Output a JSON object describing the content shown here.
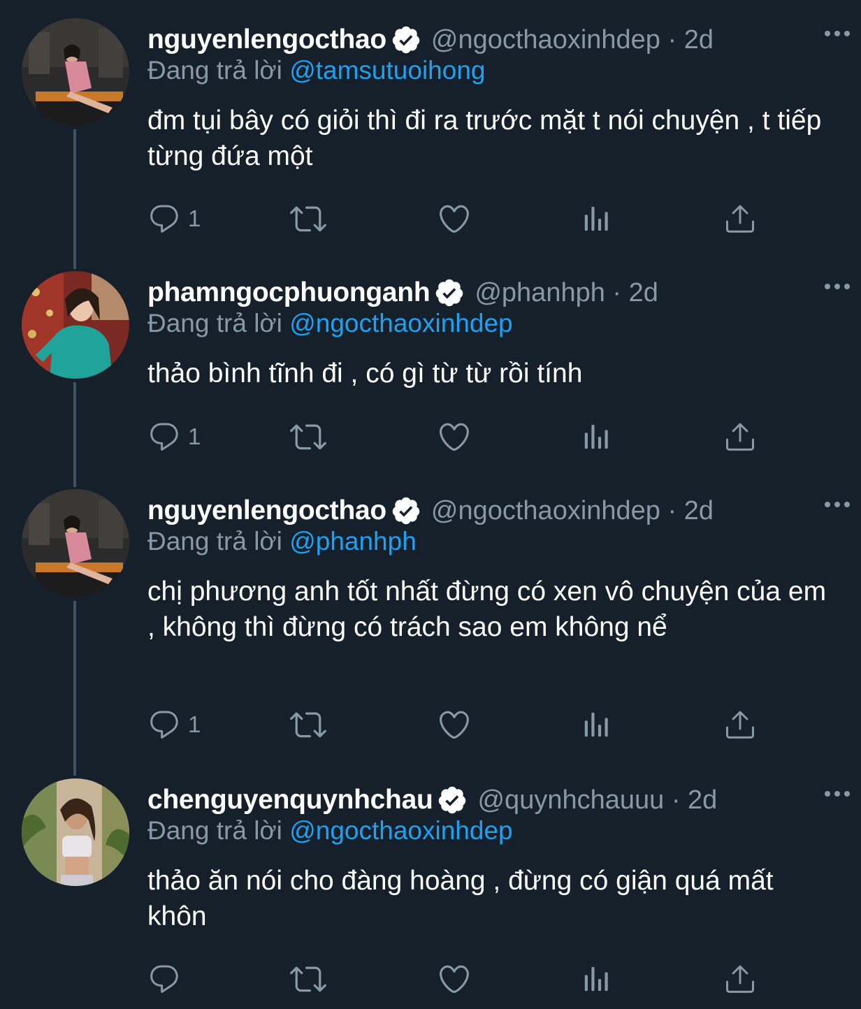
{
  "tweets": [
    {
      "name": "nguyenlengocthao",
      "handle": "@ngocthaoxinhdep",
      "sep": "·",
      "time": "2d",
      "reply_prefix": "Đang trả lời",
      "reply_to": "@tamsutuoihong",
      "text": "đm tụi bây có giỏi thì đi ra trước mặt t nói chuyện , t tiếp từng đứa một",
      "reply_count": "1"
    },
    {
      "name": "phamngocphuonganh",
      "handle": "@phanhph",
      "sep": "·",
      "time": "2d",
      "reply_prefix": "Đang trả lời",
      "reply_to": "@ngocthaoxinhdep",
      "text": "thảo bình tĩnh đi , có gì từ từ rồi tính",
      "reply_count": "1"
    },
    {
      "name": "nguyenlengocthao",
      "handle": "@ngocthaoxinhdep",
      "sep": "·",
      "time": "2d",
      "reply_prefix": "Đang trả lời",
      "reply_to": "@phanhph",
      "text": "chị phương anh tốt nhất đừng có xen vô chuyện của em , không thì đừng có trách sao em không nể",
      "reply_count": "1"
    },
    {
      "name": "chenguyenquynhchau",
      "handle": "@quynhchauuu",
      "sep": "·",
      "time": "2d",
      "reply_prefix": "Đang trả lời",
      "reply_to": "@ngocthaoxinhdep",
      "text": "thảo ăn nói cho đàng hoàng , đừng có giận quá mất khôn",
      "reply_count": ""
    }
  ],
  "icons": {
    "reply": "reply-icon",
    "retweet": "retweet-icon",
    "like": "heart-icon",
    "analytics": "analytics-icon",
    "share": "share-icon",
    "verified": "verified-badge-icon",
    "more": "more-icon"
  },
  "colors": {
    "background": "#15202b",
    "muted": "#8899a6",
    "link": "#1da1f2",
    "thread_line": "#3d5466"
  }
}
